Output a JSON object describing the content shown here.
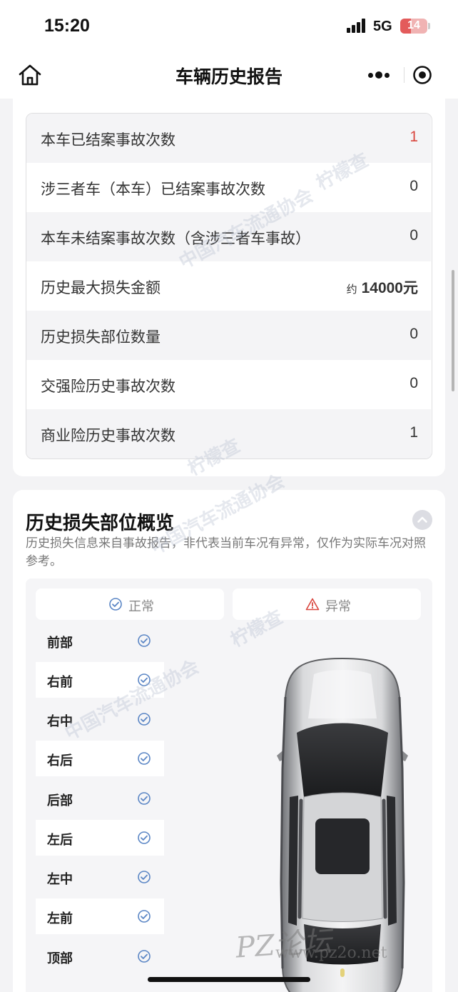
{
  "status_bar": {
    "time": "15:20",
    "network": "5G",
    "battery": "14"
  },
  "nav": {
    "title": "车辆历史报告"
  },
  "accident_stats": [
    {
      "label": "本车已结案事故次数",
      "value": "1",
      "highlight": true
    },
    {
      "label": "涉三者车（本车）已结案事故次数",
      "value": "0"
    },
    {
      "label": "本车未结案事故次数（含涉三者车事故）",
      "value": "0"
    },
    {
      "label": "历史最大损失金额",
      "value_prefix": "约",
      "value": "14000元"
    },
    {
      "label": "历史损失部位数量",
      "value": "0"
    },
    {
      "label": "交强险历史事故次数",
      "value": "0"
    },
    {
      "label": "商业险历史事故次数",
      "value": "1"
    }
  ],
  "loss_overview": {
    "title": "历史损失部位概览",
    "description": "历史损失信息来自事故报告，非代表当前车况有异常，仅作为实际车况对照参考。",
    "legend_normal": "正常",
    "legend_abnormal": "异常",
    "parts": [
      "前部",
      "右前",
      "右中",
      "右后",
      "后部",
      "左后",
      "左中",
      "左前",
      "顶部"
    ]
  },
  "watermarks": {
    "brand": "柠檬查",
    "association": "中国汽车流通协会",
    "site": "PZ论坛",
    "url": "www.pz2o.net"
  },
  "colors": {
    "highlight_red": "#d9463e",
    "normal_blue": "#5b86c5",
    "abnormal_red": "#d9463e"
  }
}
